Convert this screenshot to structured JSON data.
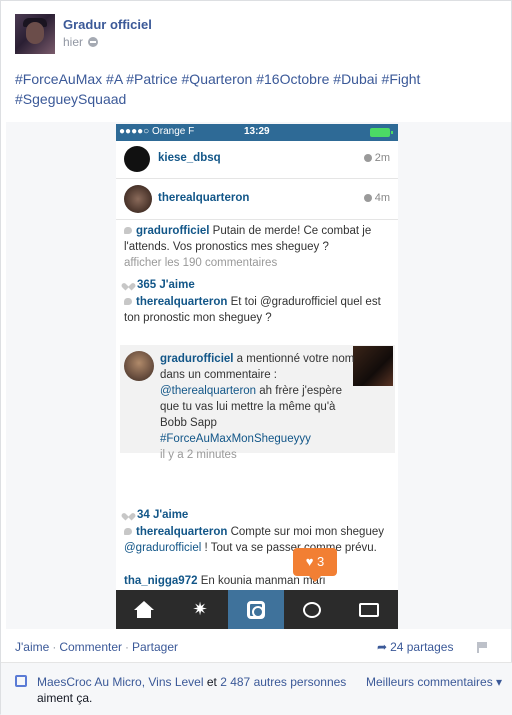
{
  "post": {
    "author": "Gradur officiel",
    "time": "hier",
    "text": "#ForceAuMax #A #Patrice #Quarteron #16Octobre #Dubai #Fight #SgegueySquaad"
  },
  "phone": {
    "status": {
      "carrier": "●●●●○ Orange F",
      "time": "13:29"
    },
    "rows": [
      {
        "user": "kiese_dbsq",
        "ago": "2m"
      },
      {
        "user": "therealquarteron",
        "ago": "4m"
      }
    ],
    "comment1": {
      "user": "gradurofficiel",
      "text": " Putain de merde! Ce combat je l'attends. Vos pronostics mes sheguey ?"
    },
    "see_all": "afficher les 190 commentaires",
    "likes1": "365 J'aime",
    "comment2": {
      "user": "therealquarteron",
      "mention": " Et toi @gradurofficiel",
      "text": " quel est ton pronostic mon sheguey ?"
    },
    "notification": {
      "user": "gradurofficiel",
      "line1": " a mentionné votre nom dans un commentaire :",
      "mention": "@therealquarteron",
      "line2": " ah frère j'espère que tu vas lui mettre la même qu'à Bobb Sapp",
      "hashtag": "#ForceAuMaxMonShegueyyy",
      "time": "il y a 2 minutes"
    },
    "likes2": "34 J'aime",
    "comment3": {
      "user": "therealquarteron",
      "text": " Compte sur moi mon sheguey ",
      "mention": "@gradurofficiel",
      "text2": " ! Tout va se passer comme prévu."
    },
    "comment4": {
      "user": "tha_nigga972",
      "text": " En kounia manman mari"
    },
    "badge_count": "3",
    "tabs": [
      "home-icon",
      "explore-icon",
      "camera-icon",
      "activity-icon",
      "profile-icon"
    ]
  },
  "footer": {
    "like": "J'aime",
    "comment": "Commenter",
    "share": "Partager",
    "shares": "24 partages",
    "likers_names": "MaesCroc Au Micro, Vins Level",
    "likers_and": " et ",
    "likers_others": "2 487 autres personnes",
    "likers_tail": " aiment ça.",
    "best_comments": "Meilleurs commentaires ▾"
  },
  "colors": {
    "fb_blue": "#3b5998",
    "ig_blue": "#125688",
    "ig_bar": "#2e6a96",
    "badge": "#f27f33"
  }
}
